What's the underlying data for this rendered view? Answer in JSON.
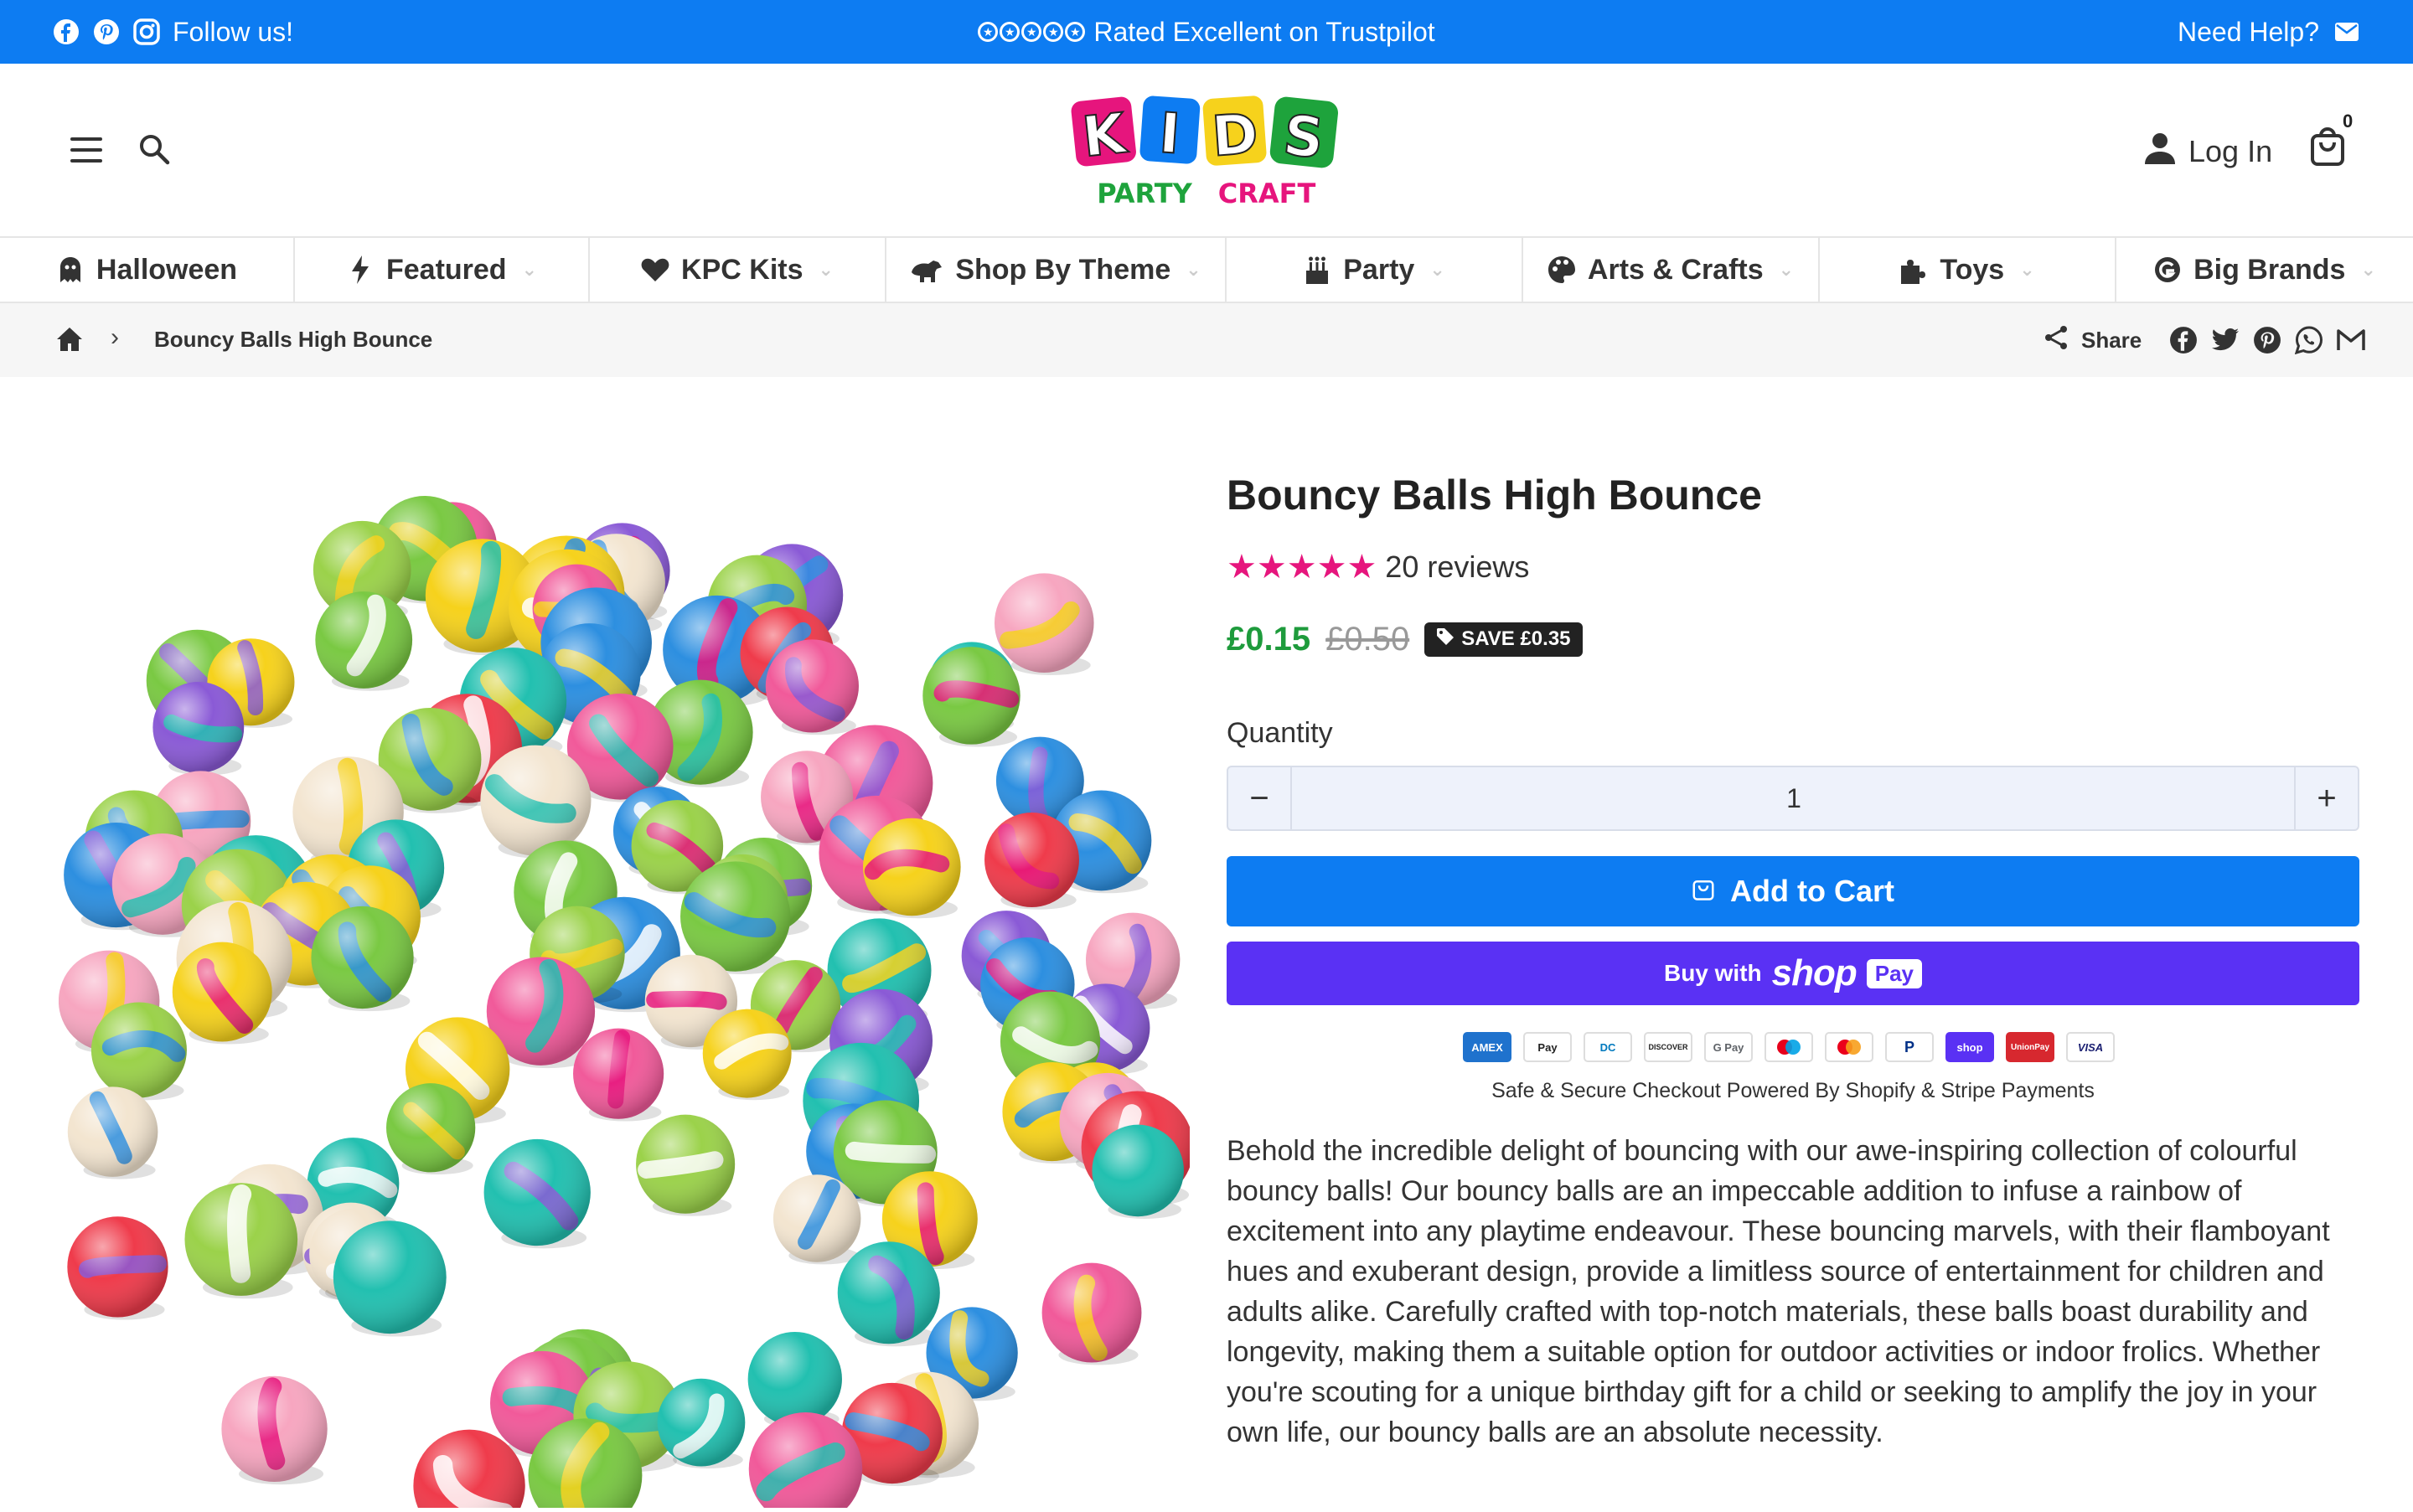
{
  "announcement": {
    "follow_label": "Follow us!",
    "rating_text": "Rated Excellent on Trustpilot",
    "help_label": "Need Help?"
  },
  "header": {
    "logo_word": "KIDS",
    "logo_sub_1": "PARTY",
    "logo_sub_2": "CRAFT",
    "login_label": "Log In",
    "cart_count": "0"
  },
  "nav": {
    "items": [
      {
        "label": "Halloween",
        "icon": "ghost-icon",
        "has_dropdown": false
      },
      {
        "label": "Featured",
        "icon": "bolt-icon",
        "has_dropdown": true
      },
      {
        "label": "KPC Kits",
        "icon": "heart-icon",
        "has_dropdown": true
      },
      {
        "label": "Shop By Theme",
        "icon": "dinosaur-icon",
        "has_dropdown": true
      },
      {
        "label": "Party",
        "icon": "cake-icon",
        "has_dropdown": true
      },
      {
        "label": "Arts & Crafts",
        "icon": "palette-icon",
        "has_dropdown": true
      },
      {
        "label": "Toys",
        "icon": "puzzle-icon",
        "has_dropdown": true
      },
      {
        "label": "Big Brands",
        "icon": "brand-icon",
        "has_dropdown": true
      }
    ],
    "caret": "⌄"
  },
  "breadcrumb": {
    "separator": "›",
    "current": "Bouncy Balls High Bounce",
    "share_label": "Share"
  },
  "product": {
    "title": "Bouncy Balls High Bounce",
    "rating": 5,
    "review_count": "20 reviews",
    "price": "£0.15",
    "compare_price": "£0.50",
    "save_badge": "SAVE £0.35",
    "quantity_label": "Quantity",
    "quantity_value": "1",
    "minus": "−",
    "plus": "+",
    "add_to_cart": "Add to Cart",
    "buy_with": "Buy with",
    "shop_word": "shop",
    "pay_word": "Pay",
    "payment_methods": [
      "AMEX",
      "Pay",
      "DC",
      "DISCOVER",
      "G Pay",
      "MC",
      "Maestro",
      "P",
      "shop",
      "UnionPay",
      "VISA"
    ],
    "secure_note": "Safe & Secure Checkout Powered By Shopify & Stripe Payments",
    "description": "Behold the incredible delight of bouncing with our awe-inspiring collection of colourful bouncy balls! Our bouncy balls are an impeccable addition to infuse a rainbow of excitement into any playtime endeavour. These bouncing marvels, with their flamboyant hues and exuberant design, provide a limitless source of entertainment for children and adults alike. Carefully crafted with top-notch materials, these balls boast durability and longevity, making them a suitable option for outdoor activities or indoor frolics. Whether you're scouting for a unique birthday gift for a child or seeking to amplify the joy in your own life, our bouncy balls are an absolute necessity."
  },
  "colors": {
    "brand_blue": "#0d7cf2",
    "shop_pay_purple": "#5a31f4",
    "price_green": "#1e9b3c",
    "star_pink": "#e6157d"
  }
}
